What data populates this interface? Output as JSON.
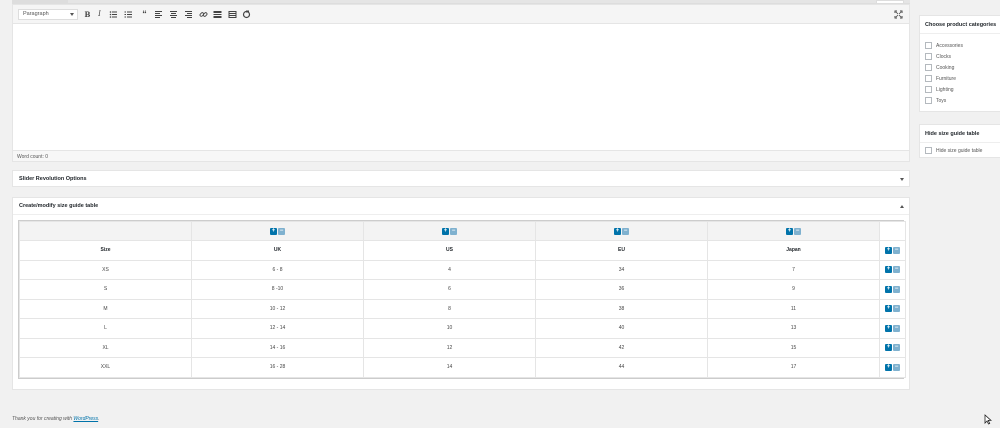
{
  "editor": {
    "format_select": "Paragraph",
    "word_count": "Word count: 0",
    "toolbar_icons": [
      "bold-icon",
      "italic-icon",
      "bullet-list-icon",
      "numbered-list-icon",
      "blockquote-icon",
      "align-left-icon",
      "align-center-icon",
      "align-right-icon",
      "link-icon",
      "read-more-icon",
      "toolbar-toggle-icon",
      "refresh-icon"
    ]
  },
  "slider_box": {
    "title": "Slider Revolution Options"
  },
  "size_guide": {
    "title": "Create/modify size guide table",
    "headers": [
      "Size",
      "UK",
      "US",
      "EU",
      "Japan"
    ],
    "rows": [
      [
        "XS",
        "6 - 8",
        "4",
        "34",
        "7"
      ],
      [
        "S",
        "8 -10",
        "6",
        "36",
        "9"
      ],
      [
        "M",
        "10 - 12",
        "8",
        "38",
        "11"
      ],
      [
        "L",
        "12 - 14",
        "10",
        "40",
        "13"
      ],
      [
        "XL",
        "14 - 16",
        "12",
        "42",
        "15"
      ],
      [
        "XXL",
        "16 - 28",
        "14",
        "44",
        "17"
      ]
    ],
    "plus": "+",
    "minus": "−"
  },
  "categories_box": {
    "title": "Choose product categories",
    "items": [
      "Accessories",
      "Clocks",
      "Cooking",
      "Furniture",
      "Lighting",
      "Toys"
    ]
  },
  "hide_box": {
    "title": "Hide size guide table",
    "checkbox_label": "Hide size guide table"
  },
  "footer": {
    "prefix": "Thank you for creating with ",
    "link": "WordPress",
    "suffix": "."
  },
  "colors": {
    "accent": "#0073aa",
    "accent_light": "#7fb1cf",
    "background": "#f1f1f1"
  }
}
